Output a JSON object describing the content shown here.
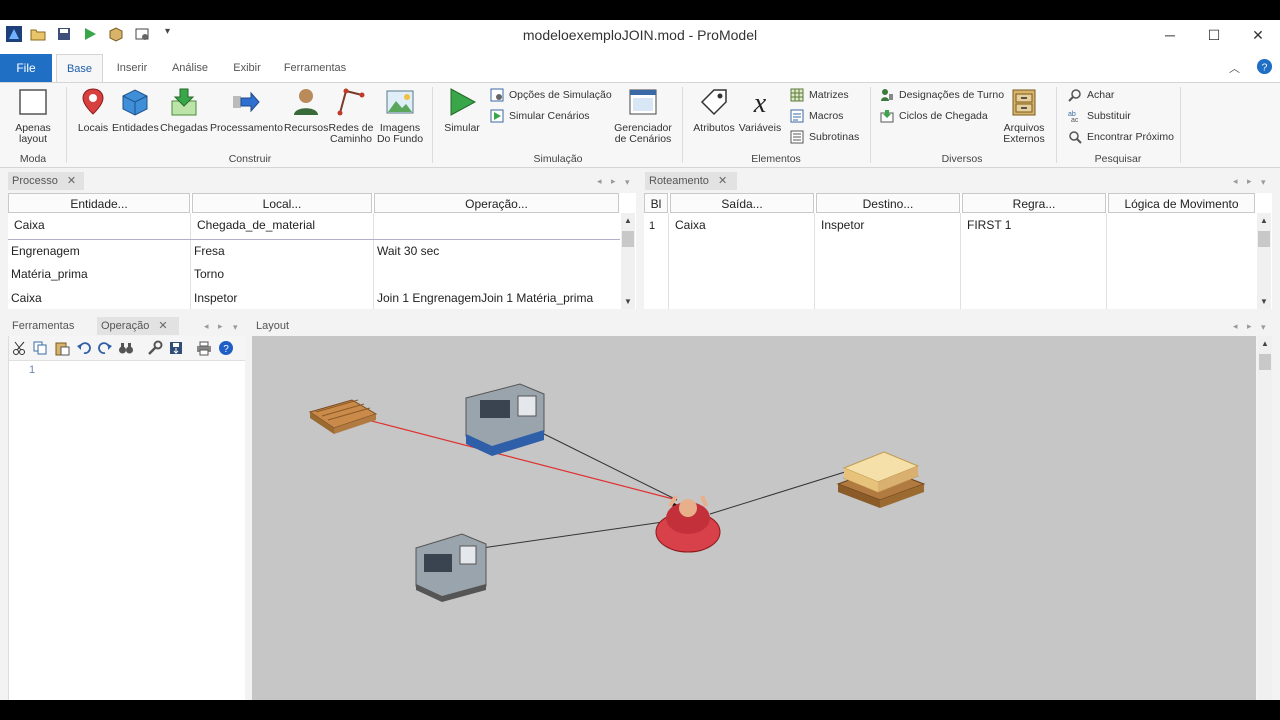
{
  "window": {
    "title": "modeloexemploJOIN.mod - ProModel",
    "minimize": "─",
    "maximize": "☐",
    "close": "✕"
  },
  "ribbon_tabs": {
    "file": "File",
    "items": [
      "Base",
      "Inserir",
      "Análise",
      "Exibir",
      "Ferramentas"
    ]
  },
  "ribbon": {
    "moda": {
      "layout_only": "Apenas layout",
      "group": "Moda"
    },
    "construir": {
      "group": "Construir",
      "buttons": [
        "Locais",
        "Entidades",
        "Chegadas",
        "Processamento",
        "Recursos",
        "Redes de Caminho",
        "Imagens Do Fundo"
      ]
    },
    "simulacao": {
      "group": "Simulação",
      "simular": "Simular",
      "opcoes": "Opções de Simulação",
      "cenarios": "Simular Cenários",
      "gerenciador": "Gerenciador de Cenários"
    },
    "elementos": {
      "group": "Elementos",
      "atributos": "Atributos",
      "variaveis": "Variáveis",
      "matrizes": "Matrizes",
      "macros": "Macros",
      "subrotinas": "Subrotinas"
    },
    "diversos": {
      "group": "Diversos",
      "turno": "Designações de Turno",
      "ciclos": "Ciclos de Chegada",
      "arquivos": "Arquivos Externos"
    },
    "pesquisar": {
      "group": "Pesquisar",
      "achar": "Achar",
      "substituir": "Substituir",
      "proximo": "Encontrar Próximo"
    }
  },
  "processo": {
    "tab": "Processo",
    "headers": [
      "Entidade...",
      "Local...",
      "Operação..."
    ],
    "rows": [
      [
        "Caixa",
        "Chegada_de_material",
        ""
      ],
      [
        "Engrenagem",
        "Fresa",
        "Wait 30 sec"
      ],
      [
        "Matéria_prima",
        "Torno",
        ""
      ],
      [
        "Caixa",
        "Inspetor",
        "Join 1 EngrenagemJoin 1 Matéria_prima"
      ]
    ]
  },
  "roteamento": {
    "tab": "Roteamento",
    "headers": [
      "Bl",
      "Saída...",
      "Destino...",
      "Regra...",
      "Lógica de Movimento"
    ],
    "rows": [
      [
        "1",
        "Caixa",
        "Inspetor",
        "FIRST 1",
        ""
      ]
    ]
  },
  "tools_panel": {
    "tabs": [
      "Ferramentas",
      "Operação"
    ],
    "line_number": "1"
  },
  "layout_panel": {
    "tab": "Layout"
  },
  "colors": {
    "accent": "#1f6fc5",
    "layout_bg": "#c6c6c6",
    "red_path": "#e03030"
  }
}
